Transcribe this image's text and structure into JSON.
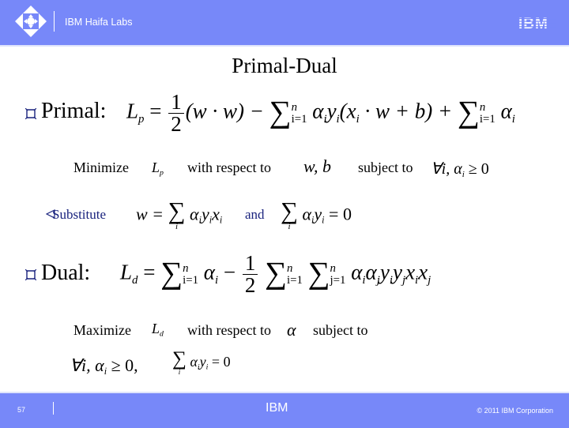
{
  "header": {
    "org_title": "IBM Haifa Labs",
    "logo_icon": "diamond-logo-icon",
    "brand_logo": "IBM",
    "brand_color": "#7788f9"
  },
  "slide": {
    "title": "Primal-Dual",
    "bullets": {
      "primal_label": "Primal:",
      "dual_label": "Dual:",
      "bullet_icon": "square-bullet-icon",
      "sub_bullet_icon": "arrow-left-bullet-icon"
    },
    "primal": {
      "equation": {
        "lhs": "L",
        "lhs_sub": "p",
        "eq": "=",
        "half_num": "1",
        "half_den": "2",
        "term1": "(w · w) −",
        "sum_sup": "n",
        "sum_sub": "i=1",
        "term2": "α",
        "term2_sub": "i",
        "term2b": "y",
        "term2b_sub": "i",
        "term3": "(x",
        "term3_sub": "i",
        "term3b": " · w + b) +",
        "term4": "α",
        "term4_sub": "i"
      },
      "minimize_label": "Minimize",
      "objective": "L",
      "objective_sub": "p",
      "wrt_label": "with respect to",
      "variables": "w, b",
      "subject_label": "subject to",
      "constraint": "∀i, α",
      "constraint_sub": "i",
      "constraint_rhs": " ≥ 0"
    },
    "substitute": {
      "label": "Substitute",
      "eq1_lhs": "w =",
      "eq1_sum_sub": "i",
      "eq1_rhs": "α",
      "and_label": "and",
      "eq2_sum_sub": "i",
      "eq2_rhs": "= 0"
    },
    "dual": {
      "equation": {
        "lhs": "L",
        "lhs_sub": "d",
        "eq": "=",
        "sum1_sup": "n",
        "sum1_sub": "i=1",
        "alpha": "α",
        "alpha_sub": "i",
        "minus": "−",
        "half_num": "1",
        "half_den": "2",
        "sum2_sup": "n",
        "sum2_sub": "i=1",
        "sum3_sup": "n",
        "sum3_sub": "j=1"
      },
      "maximize_label": "Maximize",
      "objective": "L",
      "objective_sub": "d",
      "wrt_label": "with respect to",
      "variable": "α",
      "subject_label": "subject to",
      "constraint1": "∀i, α",
      "constraint1_sub": "i",
      "constraint1_rhs": " ≥ 0,",
      "constraint2_sum_sub": "i",
      "constraint2_rhs": "= 0"
    }
  },
  "footer": {
    "page_number": "57",
    "center_brand": "IBM",
    "copyright": "© 2011 IBM Corporation"
  }
}
